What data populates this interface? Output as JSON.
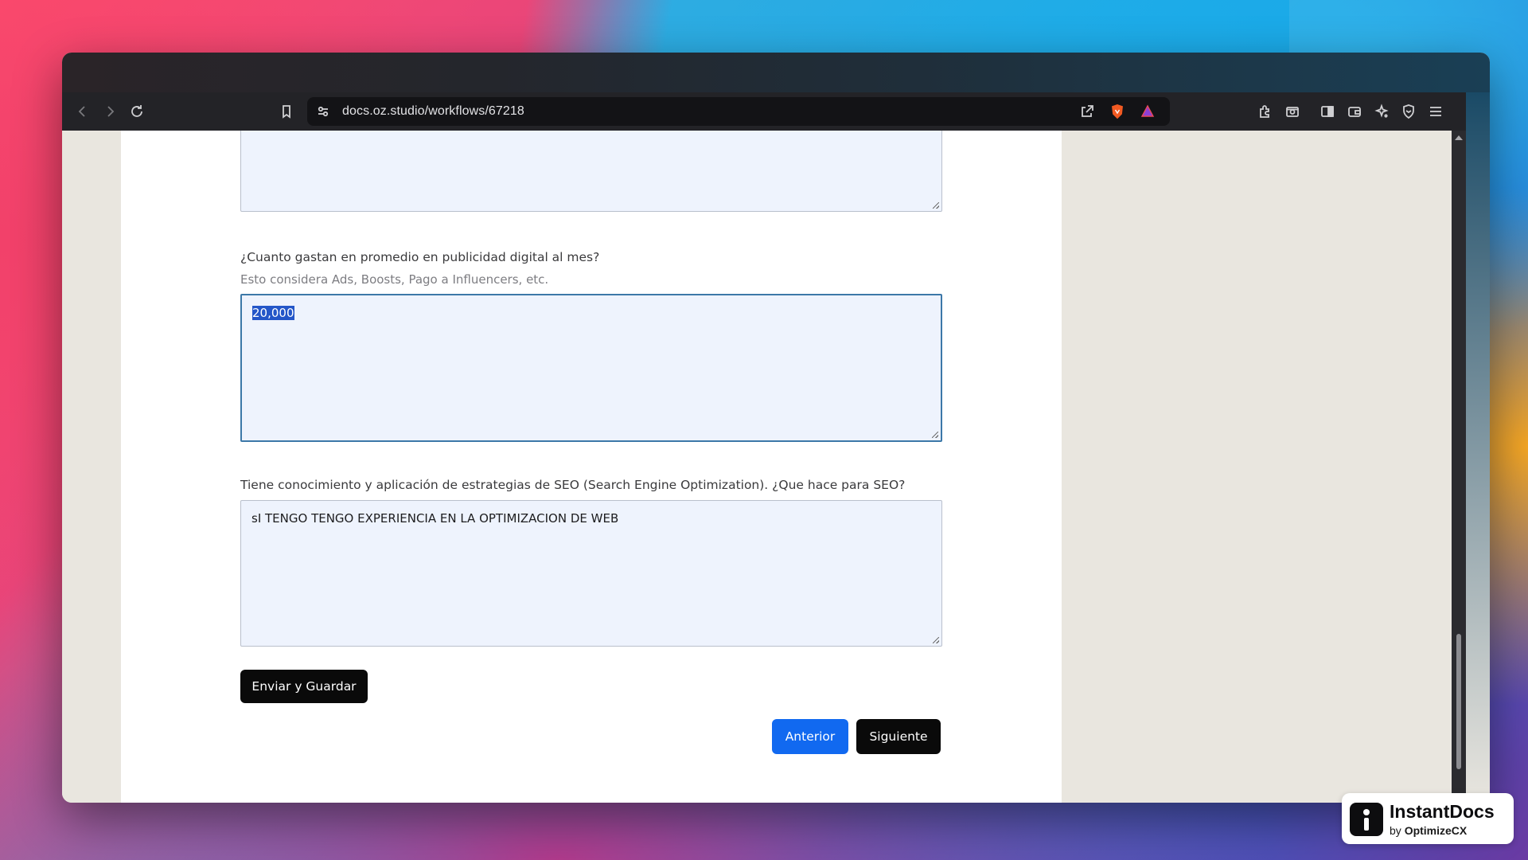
{
  "browser": {
    "url": "docs.oz.studio/workflows/67218"
  },
  "form": {
    "question_ads": "¿Cuanto gastan en promedio en publicidad digital al mes?",
    "hint_ads": "Esto considera Ads, Boosts, Pago a Influencers, etc.",
    "answer_ads": "20,000",
    "question_seo": "Tiene conocimiento y aplicación de estrategias de SEO (Search Engine Optimization). ¿Que hace para SEO?",
    "answer_seo": "sI TENGO TENGO EXPERIENCIA EN LA OPTIMIZACION DE WEB",
    "submit_label": "Enviar y Guardar",
    "prev_label": "Anterior",
    "next_label": "Siguiente"
  },
  "watermark": {
    "title": "InstantDocs",
    "by": "by",
    "company": "OptimizeCX"
  },
  "colors": {
    "primary_button": "#1169f0",
    "dark_button": "#0a0a0a",
    "field_background": "#eef3fd"
  }
}
